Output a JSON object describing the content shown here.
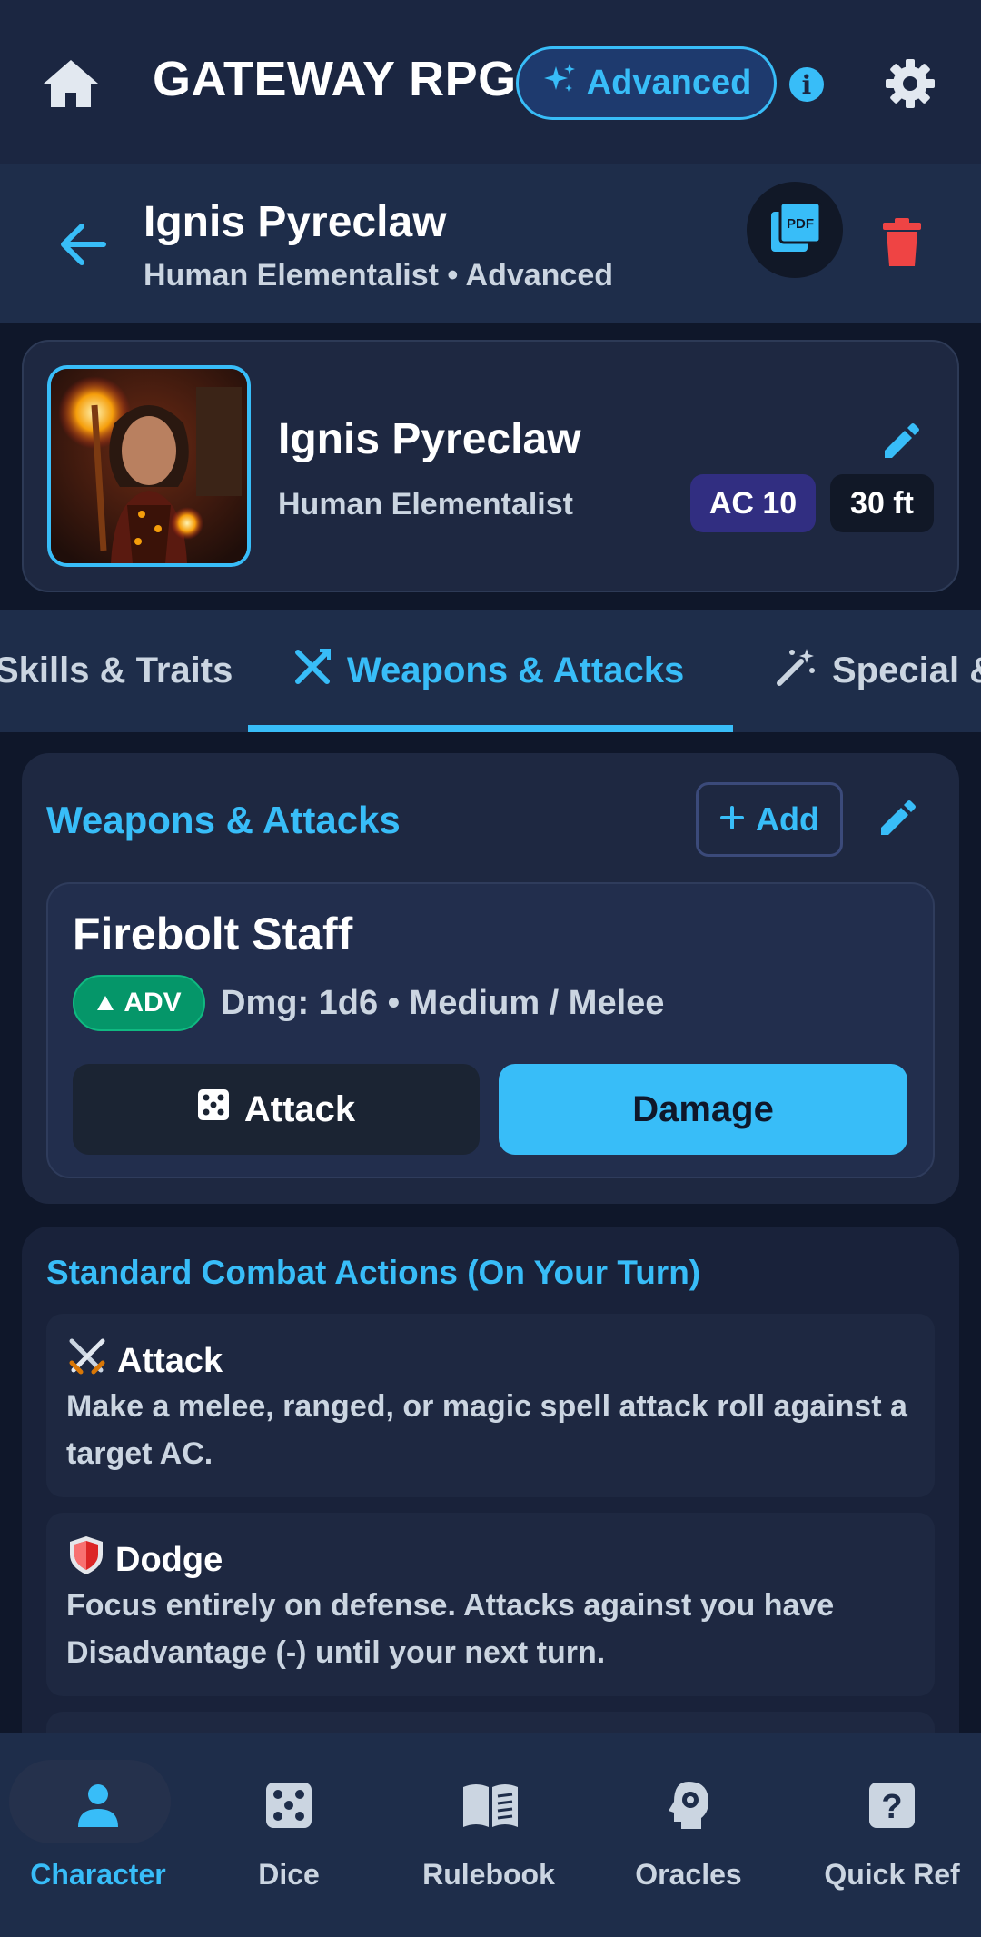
{
  "header": {
    "app_title": "GATEWAY RPG",
    "mode_label": "Advanced",
    "info_glyph": "i",
    "icons": [
      "home-icon",
      "sparkles-icon",
      "info-icon",
      "gear-icon"
    ]
  },
  "character_bar": {
    "name": "Ignis Pyreclaw",
    "subtitle": "Human Elementalist • Advanced",
    "icons": [
      "back-arrow-icon",
      "pdf-icon",
      "trash-icon"
    ]
  },
  "profile": {
    "name": "Ignis Pyreclaw",
    "subtitle": "Human Elementalist",
    "ac": "AC 10",
    "speed": "30 ft",
    "icons": [
      "edit-icon"
    ]
  },
  "tabs": [
    {
      "label": "Skills & Traits",
      "icon": ""
    },
    {
      "label": "Weapons & Attacks",
      "icon": "crossed-swords-icon",
      "active": true
    },
    {
      "label": "Special & Abilities",
      "icon": "magic-wand-icon"
    }
  ],
  "weapons": {
    "title": "Weapons & Attacks",
    "add_label": "Add",
    "items": [
      {
        "name": "Firebolt Staff",
        "badge": "ADV",
        "stats": "Dmg: 1d6  •  Medium / Melee",
        "attack_label": "Attack",
        "damage_label": "Damage"
      }
    ]
  },
  "combat_actions": {
    "title": "Standard Combat Actions (On Your Turn)",
    "items": [
      {
        "name": "Attack",
        "icon": "crossed-swords-icon",
        "description": "Make a melee, ranged, or magic spell attack roll against a target AC."
      },
      {
        "name": "Dodge",
        "icon": "shield-icon",
        "description": "Focus entirely on defense. Attacks against you have Disadvantage (-) until your next turn."
      }
    ]
  },
  "bottom_nav": [
    {
      "label": "Character",
      "icon": "person-icon",
      "active": true
    },
    {
      "label": "Dice",
      "icon": "dice-icon"
    },
    {
      "label": "Rulebook",
      "icon": "book-icon"
    },
    {
      "label": "Oracles",
      "icon": "head-gear-icon"
    },
    {
      "label": "Quick Ref",
      "icon": "help-icon"
    }
  ],
  "colors": {
    "accent": "#38bdf8",
    "background": "#0f172a",
    "panel": "#1e2841",
    "danger": "#ef4444",
    "success": "#059669",
    "ac_badge": "#312e81"
  }
}
